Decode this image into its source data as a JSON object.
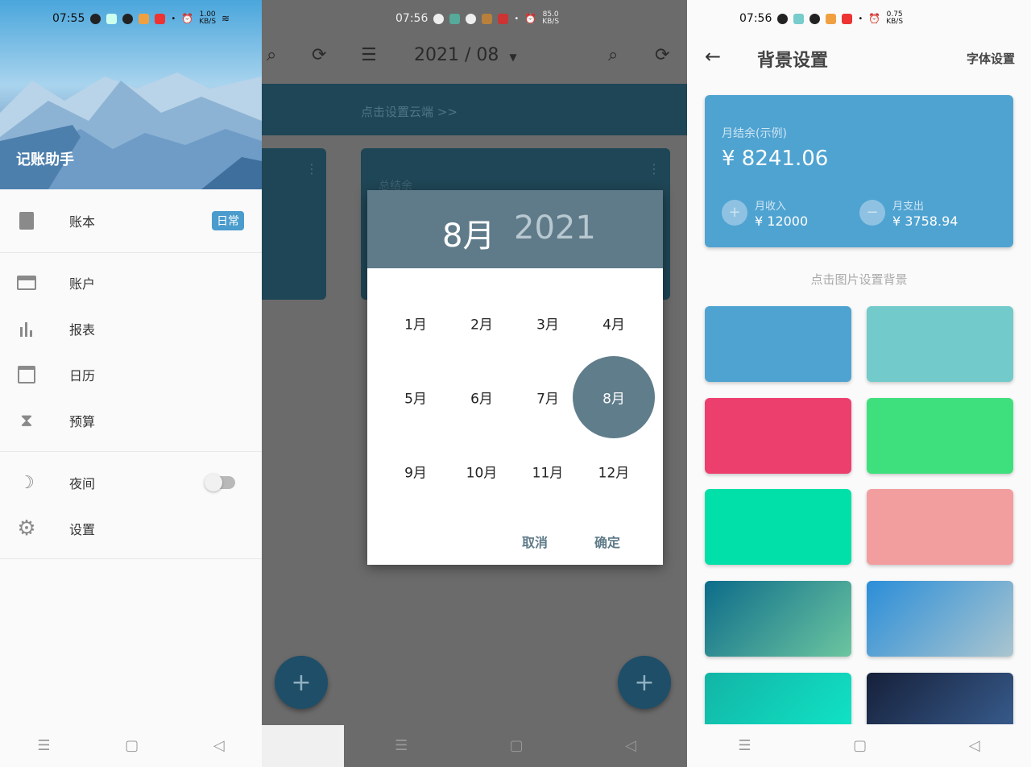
{
  "left_screen": {
    "status": {
      "time": "07:55",
      "speed": "1.00",
      "speed_unit": "KB/S"
    },
    "header_title": "记账助手",
    "menu": [
      {
        "label": "账本",
        "icon": "book-icon",
        "badge": "日常"
      },
      {
        "label": "账户",
        "icon": "credit-card-icon"
      },
      {
        "label": "报表",
        "icon": "bar-chart-icon"
      },
      {
        "label": "日历",
        "icon": "calendar-icon"
      },
      {
        "label": "预算",
        "icon": "hourglass-icon"
      },
      {
        "label": "夜间",
        "icon": "moon-icon",
        "toggle": false
      },
      {
        "label": "设置",
        "icon": "gear-icon"
      }
    ]
  },
  "middle_screen": {
    "status": {
      "time": "07:56",
      "speed": "85.0",
      "speed_unit": "KB/S"
    },
    "toolbar_title": "2021 / 08",
    "banner_text": "点击设置云端 >>",
    "card_label": "总结余",
    "dialog": {
      "selected_month": "8月",
      "selected_year": "2021",
      "months": [
        "1月",
        "2月",
        "3月",
        "4月",
        "5月",
        "6月",
        "7月",
        "8月",
        "9月",
        "10月",
        "11月",
        "12月"
      ],
      "selected_index": 7,
      "cancel": "取消",
      "confirm": "确定",
      "accent": "#607d8b"
    }
  },
  "right_screen": {
    "status": {
      "time": "07:56",
      "speed": "0.75",
      "speed_unit": "KB/S"
    },
    "title": "背景设置",
    "font_settings": "字体设置",
    "preview": {
      "balance_label": "月结余(示例)",
      "balance": "¥ 8241.06",
      "income_label": "月收入",
      "income": "¥ 12000",
      "expense_label": "月支出",
      "expense": "¥ 3758.94",
      "color": "#4fa3d1"
    },
    "hint": "点击图片设置背景",
    "swatches": [
      "#4fa3d1",
      "#72cacb",
      "#ec3f6e",
      "#3ee07d",
      "#00e0a8",
      "#f29d9e",
      "linear-gradient(135deg,#0d6c8a,#6cc6a0)",
      "linear-gradient(135deg,#2b8ed8,#aac5cf)",
      "linear-gradient(135deg,#12b4a6,#10e8c8)",
      "linear-gradient(135deg,#16203a,#3b6194)"
    ]
  }
}
